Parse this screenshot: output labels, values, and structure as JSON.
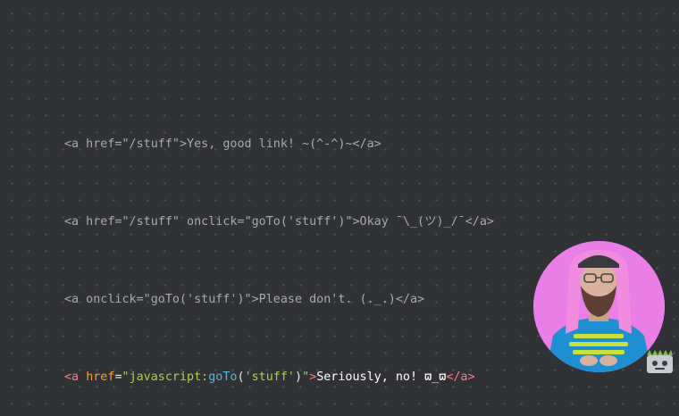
{
  "code_lines": [
    {
      "text": "<a href=\"/stuff\">Yes, good link! ~(^-^)~</a>"
    },
    {
      "text": "<a href=\"/stuff\" onclick=\"goTo('stuff')\">Okay ¯\\_(ツ)_/¯</a>"
    },
    {
      "text": "<a onclick=\"goTo('stuff')\">Please don't. (._.)</a>"
    }
  ],
  "highlighted_line": {
    "tag_open": "<a",
    "attr_name": "href",
    "equals": "=",
    "quote_open": "\"",
    "protocol": "javascript:",
    "func_name": "goTo",
    "paren_open": "(",
    "arg": "'stuff'",
    "paren_close": ")",
    "quote_close": "\"",
    "tag_gt": ">",
    "link_text": "Seriously, no! ϖ_ϖ",
    "tag_close": "</a>"
  },
  "colors": {
    "background": "#303235",
    "dim_code": "#a9aaad",
    "tag": "#ff7a86",
    "attribute": "#f4a13e",
    "string": "#a9d34a",
    "function": "#4cb8e8",
    "link_text": "#ffffff",
    "presenter_ring": "#e97ee6"
  },
  "presenter": {
    "icon": "presenter-video-icon"
  },
  "logo": {
    "icon": "devtools-robot-logo-icon"
  }
}
